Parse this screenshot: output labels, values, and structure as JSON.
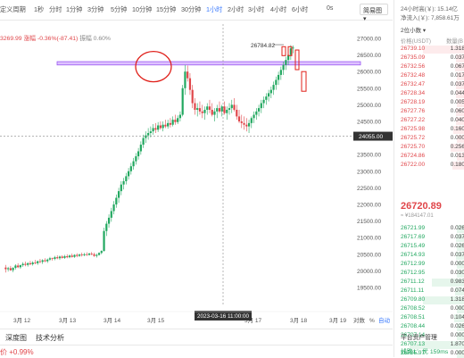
{
  "toolbar": {
    "items": [
      "定义周期",
      "1秒",
      "分时",
      "1分钟",
      "3分钟",
      "5分钟",
      "10分钟",
      "15分钟",
      "30分钟",
      "1小时",
      "2小时",
      "3小时",
      "4小时",
      "6小时"
    ],
    "active_index": 9,
    "more": "0s",
    "dropdown": "简易图"
  },
  "info": {
    "price": "3269.99",
    "change": "涨幅 -0.36%(-87.41)",
    "amplitude": "振幅 0.60%"
  },
  "chart": {
    "y_ticks": [
      "27000.00",
      "26500.00",
      "26000.00",
      "25500.00",
      "25000.00",
      "24500.00",
      "24000.00",
      "23500.00",
      "23000.00",
      "22500.00",
      "22000.00",
      "21500.00",
      "21000.00",
      "20500.00",
      "20000.00",
      "19500.00"
    ],
    "x_ticks": [
      "3月 12",
      "3月 13",
      "3月 14",
      "3月 15",
      "3月 17",
      "3月 18",
      "3月 19"
    ],
    "crosshair_price": "24055.00",
    "crosshair_time": "2023-03-16 11:00:00",
    "high_label": "26784.82",
    "log_toggle": "对数",
    "pct_toggle": "%",
    "auto_toggle": "自动"
  },
  "tabs": [
    "深度图",
    "技术分析"
  ],
  "bottom": {
    "change": "价 +0.99%"
  },
  "side": {
    "high24": "24小时高(￥): 15.14亿",
    "volume": "净流入(￥): 7,858.61万",
    "interval": "2位小数",
    "col_price": "价格(USDT)",
    "col_qty": "数量(B",
    "asks": [
      [
        "26739.10",
        "1.318"
      ],
      [
        "26735.09",
        "0.037"
      ],
      [
        "26732.56",
        "0.067"
      ],
      [
        "26732.48",
        "0.017"
      ],
      [
        "26732.47",
        "0.037"
      ],
      [
        "26728.34",
        "0.044"
      ],
      [
        "26728.19",
        "0.005"
      ],
      [
        "26727.76",
        "0.060"
      ],
      [
        "26727.22",
        "0.040"
      ],
      [
        "26725.98",
        "0.160"
      ],
      [
        "26725.72",
        "0.000"
      ],
      [
        "26725.70",
        "0.256"
      ],
      [
        "26724.86",
        "0.013"
      ],
      [
        "26722.00",
        "0.180"
      ]
    ],
    "last_price": "26720.89",
    "last_sub": "≈ ¥184147.01",
    "bids": [
      [
        "26721.99",
        "0.026"
      ],
      [
        "26717.69",
        "0.037"
      ],
      [
        "26715.49",
        "0.026"
      ],
      [
        "26714.93",
        "0.037"
      ],
      [
        "26712.99",
        "0.000"
      ],
      [
        "26712.95",
        "0.030"
      ],
      [
        "26711.12",
        "0.983"
      ],
      [
        "26711.11",
        "0.074"
      ],
      [
        "26709.80",
        "1.318"
      ],
      [
        "26708.52",
        "0.000"
      ],
      [
        "26708.51",
        "0.104"
      ],
      [
        "26708.44",
        "0.026"
      ],
      [
        "26707.14",
        "0.000"
      ],
      [
        "26707.13",
        "1.870"
      ],
      [
        "26705.97",
        "0.000"
      ]
    ],
    "footer_a": "平台资产管理",
    "footer_b": "线路1：优 159ms"
  },
  "candles": [
    [
      20100,
      20180,
      19950,
      20050
    ],
    [
      20050,
      20120,
      19980,
      20080
    ],
    [
      20080,
      20150,
      20000,
      20020
    ],
    [
      20020,
      20110,
      19960,
      20090
    ],
    [
      20090,
      20200,
      20040,
      20160
    ],
    [
      20160,
      20230,
      20080,
      20110
    ],
    [
      20110,
      20190,
      20060,
      20170
    ],
    [
      20170,
      20260,
      20120,
      20210
    ],
    [
      20210,
      20280,
      20140,
      20180
    ],
    [
      20180,
      20260,
      20130,
      20230
    ],
    [
      20230,
      20300,
      20170,
      20200
    ],
    [
      20200,
      20290,
      20160,
      20250
    ],
    [
      20250,
      20330,
      20200,
      20230
    ],
    [
      20230,
      20310,
      20180,
      20290
    ],
    [
      20290,
      20360,
      20230,
      20270
    ],
    [
      20270,
      20350,
      20210,
      20320
    ],
    [
      20320,
      20380,
      20260,
      20290
    ],
    [
      20290,
      20370,
      20240,
      20340
    ],
    [
      20340,
      20420,
      20300,
      20380
    ],
    [
      20380,
      20400,
      20310,
      20360
    ],
    [
      20360,
      20450,
      20320,
      20410
    ],
    [
      20410,
      20470,
      20350,
      20380
    ],
    [
      20380,
      20460,
      20330,
      20430
    ],
    [
      20430,
      20470,
      20370,
      20390
    ],
    [
      20390,
      20480,
      20360,
      20440
    ],
    [
      20440,
      20500,
      20380,
      20410
    ],
    [
      20410,
      20490,
      20380,
      20460
    ],
    [
      20460,
      20520,
      20400,
      20420
    ],
    [
      20420,
      20500,
      20390,
      20480
    ],
    [
      20480,
      20530,
      20410,
      20450
    ],
    [
      20450,
      20520,
      20420,
      20490
    ],
    [
      20490,
      20550,
      20430,
      20470
    ],
    [
      20470,
      20540,
      20440,
      20500
    ],
    [
      20500,
      20560,
      20450,
      20480
    ],
    [
      20480,
      20550,
      20460,
      20520
    ],
    [
      20520,
      20570,
      20470,
      20500
    ],
    [
      20500,
      20550,
      20420,
      20450
    ],
    [
      20450,
      20520,
      20400,
      20480
    ],
    [
      20480,
      20560,
      20460,
      20540
    ],
    [
      20540,
      20620,
      20500,
      20600
    ],
    [
      20600,
      21300,
      20580,
      21200
    ],
    [
      21200,
      21500,
      21050,
      21420
    ],
    [
      21420,
      21700,
      21300,
      21600
    ],
    [
      21600,
      21900,
      21480,
      21800
    ],
    [
      21800,
      22100,
      21700,
      22000
    ],
    [
      22000,
      22300,
      21900,
      22200
    ],
    [
      22200,
      22500,
      22050,
      22400
    ],
    [
      22400,
      22700,
      22280,
      22600
    ],
    [
      22600,
      22800,
      22450,
      22700
    ],
    [
      22700,
      22950,
      22600,
      22850
    ],
    [
      22850,
      23100,
      22750,
      23000
    ],
    [
      23000,
      23250,
      22900,
      23150
    ],
    [
      23150,
      23400,
      23050,
      23300
    ],
    [
      23300,
      23550,
      23200,
      23450
    ],
    [
      23450,
      23700,
      23350,
      23600
    ],
    [
      23600,
      23900,
      23500,
      23800
    ],
    [
      23800,
      24100,
      23700,
      24000
    ],
    [
      24000,
      24200,
      23850,
      24080
    ],
    [
      24080,
      24300,
      23950,
      24150
    ],
    [
      24150,
      24350,
      24020,
      24200
    ],
    [
      24200,
      24420,
      24100,
      24300
    ],
    [
      24300,
      24450,
      24150,
      24250
    ],
    [
      24250,
      24480,
      24180,
      24380
    ],
    [
      24380,
      24500,
      24250,
      24300
    ],
    [
      24300,
      24500,
      24200,
      24400
    ],
    [
      24400,
      24550,
      24300,
      24350
    ],
    [
      24350,
      24550,
      24280,
      24450
    ],
    [
      24450,
      24600,
      24320,
      24400
    ],
    [
      24400,
      24650,
      24350,
      24550
    ],
    [
      24550,
      24700,
      24400,
      24480
    ],
    [
      24480,
      24680,
      24420,
      24600
    ],
    [
      24600,
      24800,
      24500,
      24700
    ],
    [
      24700,
      25600,
      24650,
      25500
    ],
    [
      25500,
      26200,
      25300,
      26000
    ],
    [
      26000,
      26180,
      25700,
      25800
    ],
    [
      25800,
      25950,
      25300,
      25450
    ],
    [
      25450,
      25600,
      24900,
      25050
    ],
    [
      25050,
      25200,
      24700,
      24850
    ],
    [
      24850,
      25050,
      24650,
      24900
    ],
    [
      24900,
      25100,
      24700,
      24800
    ],
    [
      24800,
      25000,
      24600,
      24750
    ],
    [
      24750,
      24950,
      24550,
      24850
    ],
    [
      24850,
      25050,
      24700,
      24950
    ],
    [
      24950,
      25150,
      24750,
      24850
    ],
    [
      24850,
      25050,
      24650,
      24700
    ],
    [
      24700,
      24900,
      24500,
      24800
    ],
    [
      24800,
      25000,
      24600,
      24900
    ],
    [
      24900,
      25100,
      24750,
      24800
    ],
    [
      24800,
      25000,
      24650,
      24950
    ],
    [
      24950,
      25100,
      24700,
      24750
    ],
    [
      24750,
      24950,
      24550,
      24850
    ],
    [
      24850,
      25050,
      24700,
      24900
    ],
    [
      24900,
      25150,
      24750,
      25000
    ],
    [
      25000,
      25200,
      24800,
      24850
    ],
    [
      24850,
      25000,
      24550,
      24650
    ],
    [
      24650,
      24850,
      24450,
      24500
    ],
    [
      24500,
      24700,
      24300,
      24450
    ],
    [
      24450,
      24650,
      24250,
      24400
    ],
    [
      24400,
      24600,
      24200,
      24350
    ],
    [
      24350,
      24550,
      24150,
      24450
    ],
    [
      24450,
      24650,
      24300,
      24600
    ],
    [
      24600,
      24800,
      24450,
      24700
    ],
    [
      24700,
      24900,
      24550,
      24800
    ],
    [
      24800,
      25000,
      24650,
      24900
    ],
    [
      24900,
      25150,
      24750,
      25050
    ],
    [
      25050,
      25250,
      24900,
      25150
    ],
    [
      25150,
      25350,
      25000,
      25250
    ],
    [
      25250,
      25450,
      25100,
      25350
    ],
    [
      25350,
      25550,
      25200,
      25450
    ],
    [
      25450,
      25700,
      25300,
      25600
    ],
    [
      25600,
      25850,
      25450,
      25750
    ],
    [
      25750,
      26000,
      25600,
      25900
    ],
    [
      25900,
      26150,
      25750,
      26050
    ],
    [
      26050,
      26300,
      25900,
      26200
    ],
    [
      26200,
      26450,
      26050,
      26350
    ],
    [
      26350,
      26600,
      26200,
      26500
    ],
    [
      26500,
      26800,
      26350,
      26700
    ],
    [
      26700,
      26785,
      26550,
      26720
    ]
  ]
}
